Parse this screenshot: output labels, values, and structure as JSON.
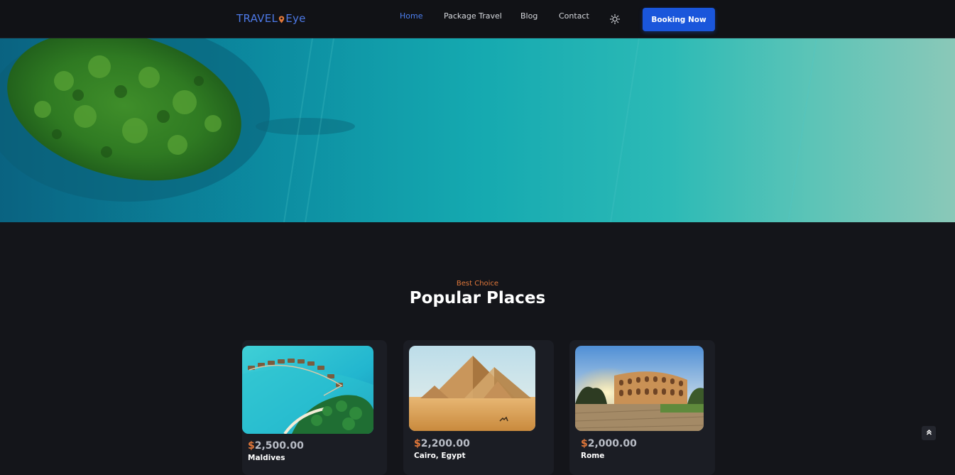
{
  "brand": {
    "name_part1": "TRAVEL",
    "name_part2": "Eye",
    "color": "#4d79e6",
    "pin_color": "#e0773a"
  },
  "nav": {
    "items": [
      {
        "label": "Home",
        "active": true
      },
      {
        "label": "Package Travel",
        "active": false
      },
      {
        "label": "Blog",
        "active": false
      },
      {
        "label": "Contact",
        "active": false
      }
    ],
    "theme_toggle_icon": "sun-icon",
    "cta_label": "Booking Now"
  },
  "hero": {
    "image": "aerial island over turquoise sea"
  },
  "section": {
    "subtitle": "Best Choice",
    "title": "Popular Places"
  },
  "places": [
    {
      "currency": "$",
      "price": "2,500.00",
      "name": "Maldives",
      "image": "overwater villas"
    },
    {
      "currency": "$",
      "price": "2,200.00",
      "name": "Cairo, Egypt",
      "image": "pyramids"
    },
    {
      "currency": "$",
      "price": "2,000.00",
      "name": "Rome",
      "image": "colosseum at sunset"
    }
  ],
  "scroll_top_icon": "chevron-double-up-icon",
  "colors": {
    "background": "#14151a",
    "accent": "#1a56db",
    "highlight": "#e0773a",
    "card": "#1b1d24"
  }
}
